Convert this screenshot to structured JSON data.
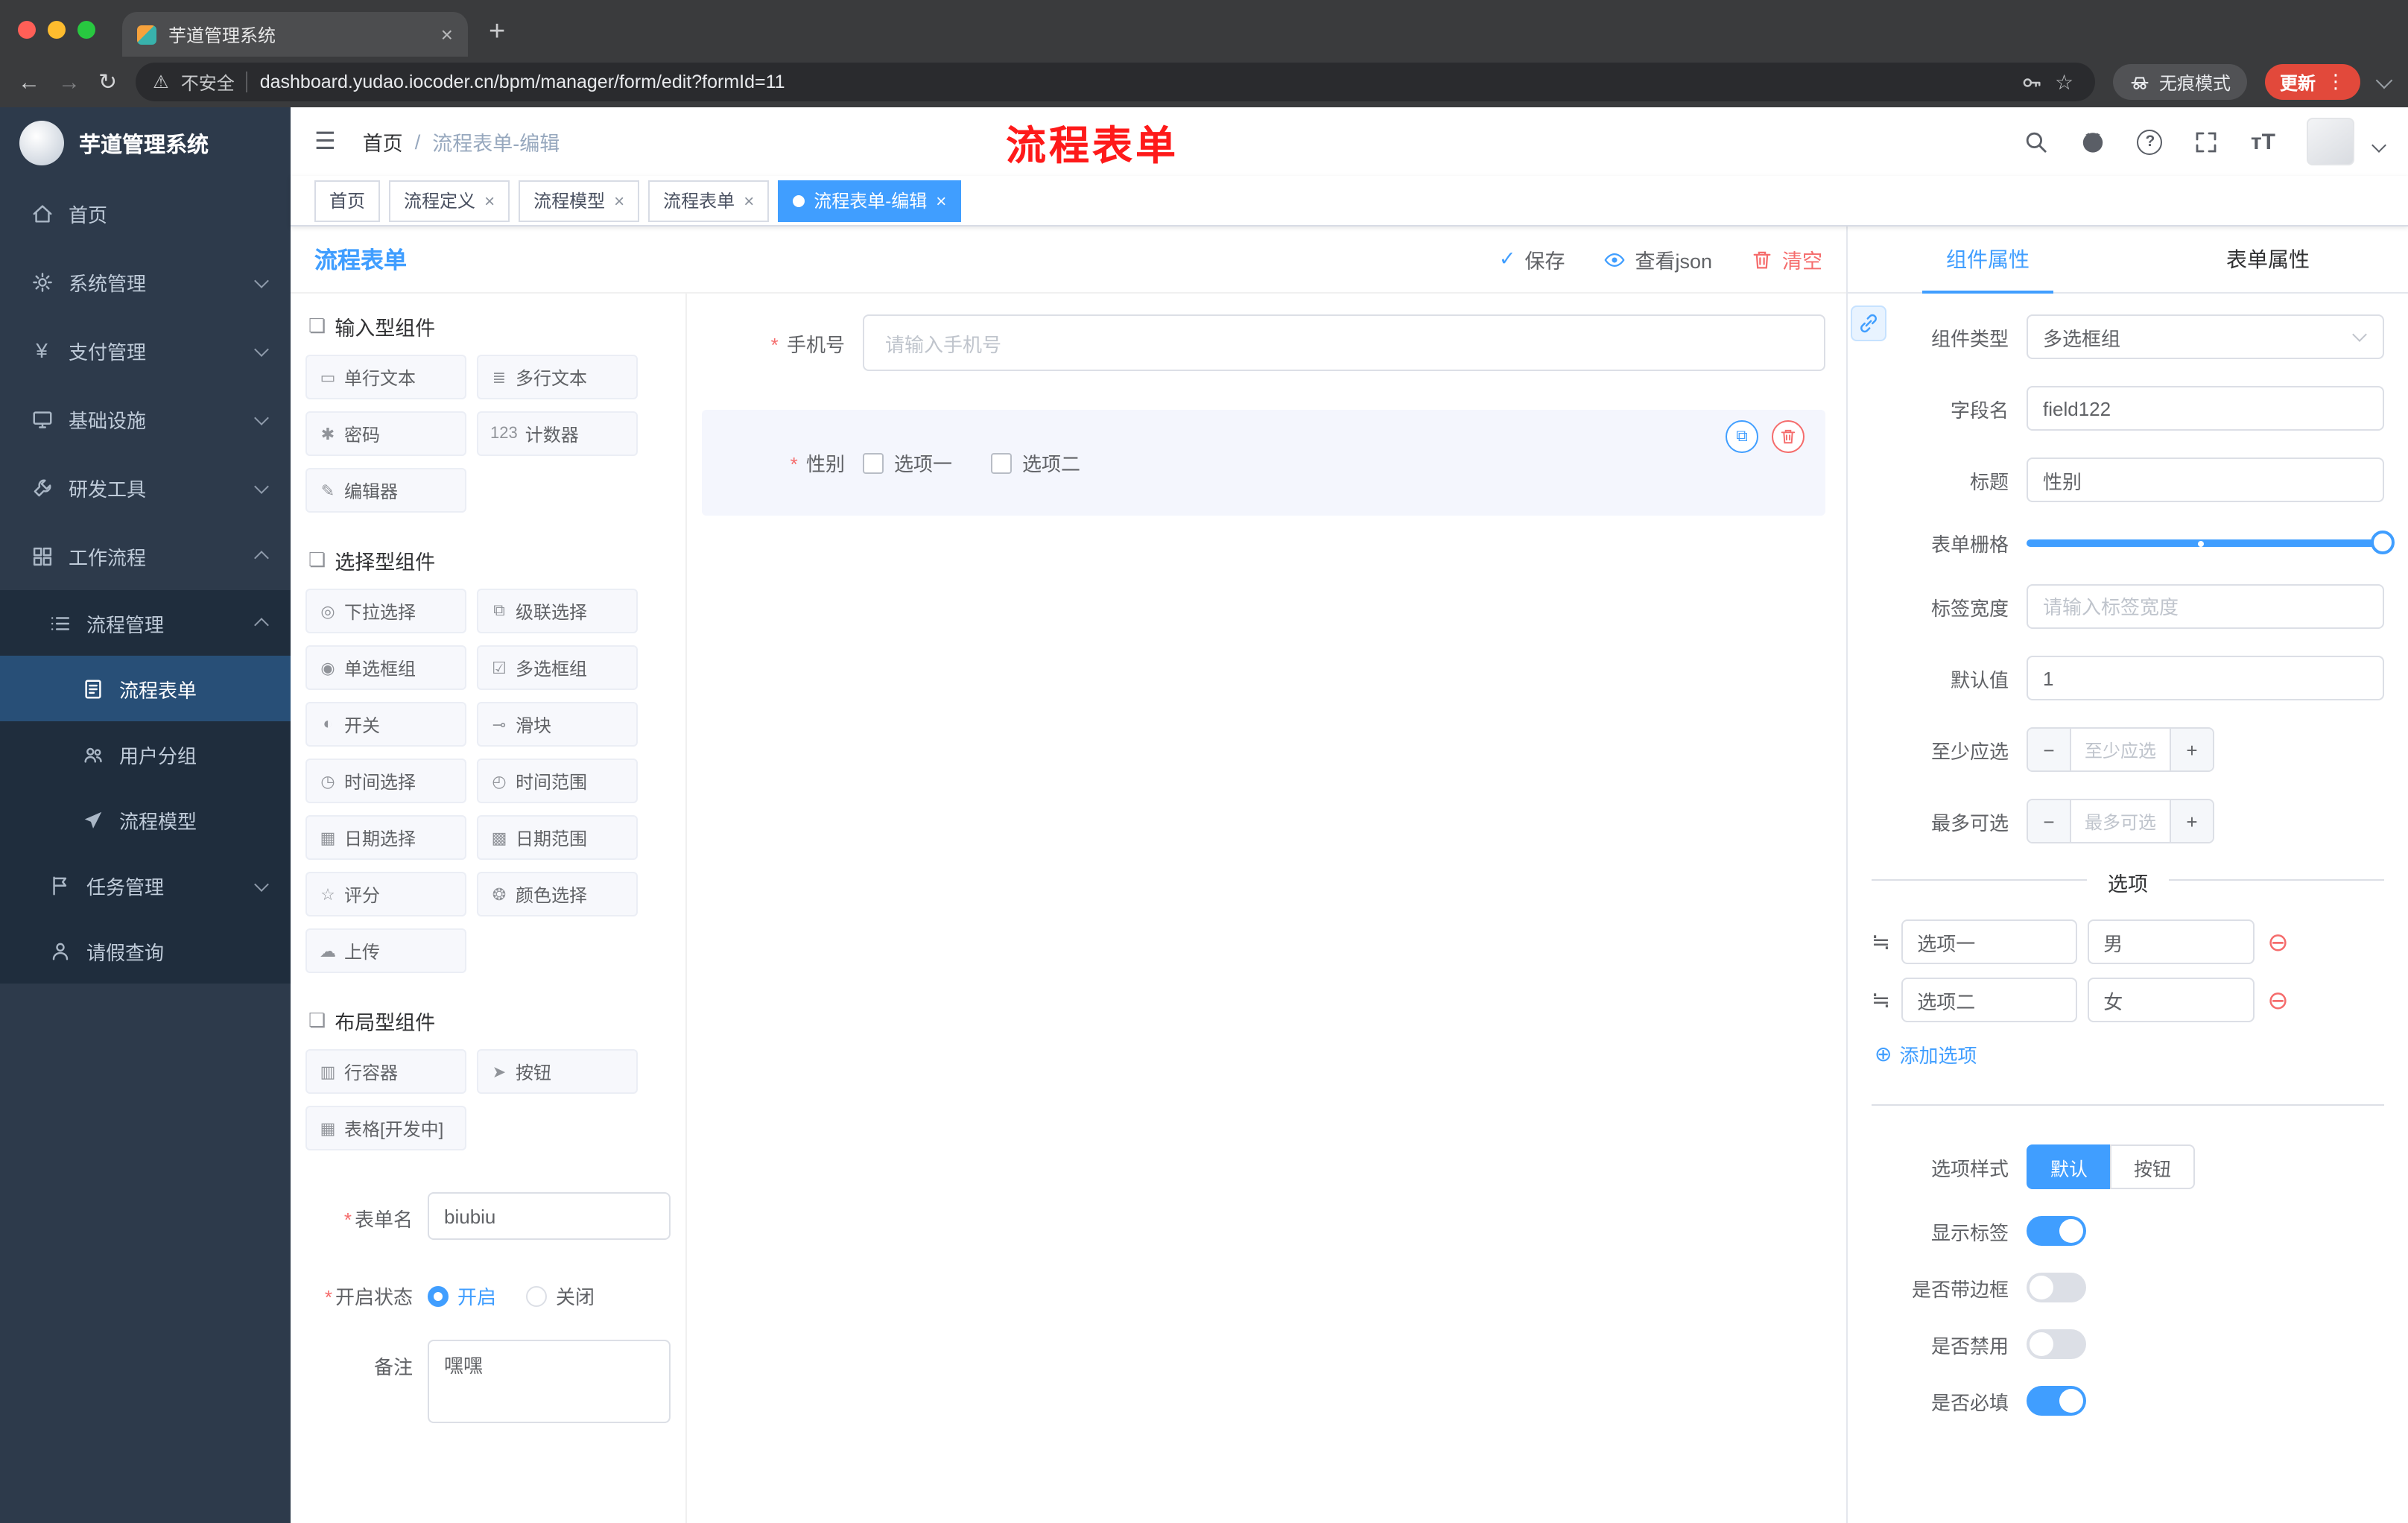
{
  "icons": {
    "hamburger": "☰",
    "back": "←",
    "forward": "→",
    "reload": "↻",
    "warning": "⚠",
    "star": "☆",
    "kebab": "⋮",
    "close": "×",
    "new_tab": "+",
    "check": "✓",
    "question": "?",
    "font_size": "тT",
    "section": "❏",
    "drag": "≒",
    "minus_circle": "⊖",
    "plus_circle": "⊕",
    "copy": "⧉",
    "minus": "−",
    "plus": "+",
    "asterisk": "*",
    "yen": "¥"
  },
  "colors": {
    "primary": "#409eff",
    "danger": "#f56c6c",
    "active_tag": "#409eff",
    "sidebar_bg": "#2d3a4b",
    "annotation": "#fe1a1a"
  },
  "browser": {
    "tab_title": "芋道管理系统",
    "security": "不安全",
    "url": "dashboard.yudao.iocoder.cn/bpm/manager/form/edit?formId=11",
    "incognito": "无痕模式",
    "update": "更新"
  },
  "sidebar": {
    "logo_title": "芋道管理系统",
    "top_items": [
      "首页",
      "系统管理",
      "支付管理",
      "基础设施",
      "研发工具",
      "工作流程"
    ],
    "process_mgmt": "流程管理",
    "process_children": [
      "流程表单",
      "用户分组",
      "流程模型"
    ],
    "task_mgmt": "任务管理",
    "leave_query": "请假查询"
  },
  "header": {
    "breadcrumb": [
      "首页",
      "流程表单-编辑"
    ],
    "breadcrumb_sep": "/",
    "annotation": "流程表单"
  },
  "page_tabs": [
    {
      "label": "首页",
      "active": false,
      "closable": false
    },
    {
      "label": "流程定义",
      "active": false,
      "closable": true
    },
    {
      "label": "流程模型",
      "active": false,
      "closable": true
    },
    {
      "label": "流程表单",
      "active": false,
      "closable": true
    },
    {
      "label": "流程表单-编辑",
      "active": true,
      "closable": true
    }
  ],
  "designer": {
    "title": "流程表单",
    "save": "保存",
    "view_json": "查看json",
    "clear": "清空"
  },
  "components_panel": {
    "sections": [
      {
        "title": "输入型组件",
        "items": [
          {
            "icon": "▭",
            "label": "单行文本"
          },
          {
            "icon": "≣",
            "label": "多行文本"
          },
          {
            "icon": "✱",
            "label": "密码"
          },
          {
            "icon": "123",
            "label": "计数器"
          },
          {
            "icon": "✎",
            "label": "编辑器"
          }
        ]
      },
      {
        "title": "选择型组件",
        "items": [
          {
            "icon": "◎",
            "label": "下拉选择"
          },
          {
            "icon": "⧉",
            "label": "级联选择"
          },
          {
            "icon": "◉",
            "label": "单选框组"
          },
          {
            "icon": "☑",
            "label": "多选框组"
          },
          {
            "icon": "◐",
            "label": "开关"
          },
          {
            "icon": "⊸",
            "label": "滑块"
          },
          {
            "icon": "◷",
            "label": "时间选择"
          },
          {
            "icon": "◴",
            "label": "时间范围"
          },
          {
            "icon": "▦",
            "label": "日期选择"
          },
          {
            "icon": "▩",
            "label": "日期范围"
          },
          {
            "icon": "☆",
            "label": "评分"
          },
          {
            "icon": "❂",
            "label": "颜色选择"
          },
          {
            "icon": "☁",
            "label": "上传"
          }
        ]
      },
      {
        "title": "布局型组件",
        "items": [
          {
            "icon": "▥",
            "label": "行容器"
          },
          {
            "icon": "➤",
            "label": "按钮"
          },
          {
            "icon": "▦",
            "label": "表格[开发中]"
          }
        ]
      }
    ],
    "meta": {
      "form_name_label": "表单名",
      "form_name_value": "biubiu",
      "status_label": "开启状态",
      "status_on": "开启",
      "status_off": "关闭",
      "status_selected": "开启",
      "remark_label": "备注",
      "remark_value": "嘿嘿"
    }
  },
  "canvas": {
    "phone": {
      "label": "手机号",
      "placeholder": "请输入手机号",
      "required": true
    },
    "gender": {
      "label": "性别",
      "options": [
        "选项一",
        "选项二"
      ],
      "required": true,
      "selected_widget": true
    }
  },
  "props": {
    "tabs": {
      "component": "组件属性",
      "form": "表单属性",
      "active": "组件属性"
    },
    "rows": {
      "type_label": "组件类型",
      "type_value": "多选框组",
      "field_label": "字段名",
      "field_value": "field122",
      "title_label": "标题",
      "title_value": "性别",
      "grid_label": "表单栅格",
      "label_width_label": "标签宽度",
      "label_width_placeholder": "请输入标签宽度",
      "default_label": "默认值",
      "default_value": "1",
      "min_label": "至少应选",
      "min_placeholder": "至少应选",
      "max_label": "最多可选",
      "max_placeholder": "最多可选"
    },
    "options_divider": "选项",
    "options": [
      {
        "label": "选项一",
        "value": "男"
      },
      {
        "label": "选项二",
        "value": "女"
      }
    ],
    "add_option": "添加选项",
    "style_label": "选项样式",
    "style_default": "默认",
    "style_button": "按钮",
    "style_selected": "默认",
    "switches": [
      {
        "label": "显示标签",
        "on": true
      },
      {
        "label": "是否带边框",
        "on": false
      },
      {
        "label": "是否禁用",
        "on": false
      },
      {
        "label": "是否必填",
        "on": true
      }
    ]
  }
}
